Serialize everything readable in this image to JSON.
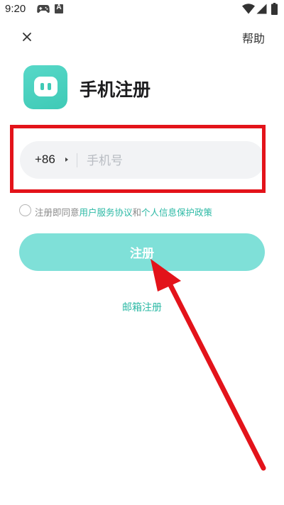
{
  "status_bar": {
    "time": "9:20",
    "icons": [
      "gamepad-icon",
      "a-notification-icon",
      "wifi-icon",
      "signal-icon",
      "battery-icon"
    ]
  },
  "header": {
    "close_icon": "close-icon",
    "help_label": "帮助"
  },
  "title": "手机注册",
  "phone_field": {
    "country_code": "+86",
    "placeholder": "手机号",
    "value": ""
  },
  "agreement": {
    "prefix": "注册即同意",
    "user_agreement": "用户服务协议",
    "conjunction": "和",
    "privacy_policy": "个人信息保护政策",
    "checked": false
  },
  "register_button": "注册",
  "email_register_link": "邮箱注册",
  "colors": {
    "accent": "#2cb9a5",
    "button": "#7fe0d8",
    "logo": "#3fcab6",
    "annotation": "#e3131a",
    "field_background": "#f2f3f5"
  }
}
